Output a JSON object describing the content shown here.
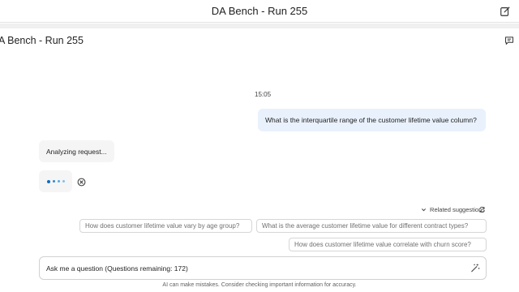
{
  "window": {
    "title": "DA Bench - Run 255"
  },
  "pane": {
    "title": "A Bench - Run 255"
  },
  "chat": {
    "timestamp": "15:05",
    "user_message": "What is the interquartile range of the customer lifetime value column?",
    "bot_status": "Analyzing request...",
    "icons": {
      "compose": "compose-icon",
      "chat": "chat-icon",
      "stop": "stop-icon",
      "refresh": "refresh-icon",
      "chevron": "chevron-down-icon",
      "wand": "magic-wand-icon"
    }
  },
  "suggestions": {
    "label": "Related suggestions",
    "items": [
      "How does customer lifetime value vary by age group?",
      "What is the average customer lifetime value for different contract types?",
      "How does customer lifetime value correlate with churn score?"
    ]
  },
  "composer": {
    "placeholder": "Ask me a question (Questions remaining: 172)"
  },
  "footer": {
    "disclaimer": "AI can make mistakes. Consider checking important information for accuracy."
  },
  "colors": {
    "accent": "#0f6cbd",
    "user_bubble": "#e9f1fc",
    "bot_bubble": "#f5f5f5"
  }
}
